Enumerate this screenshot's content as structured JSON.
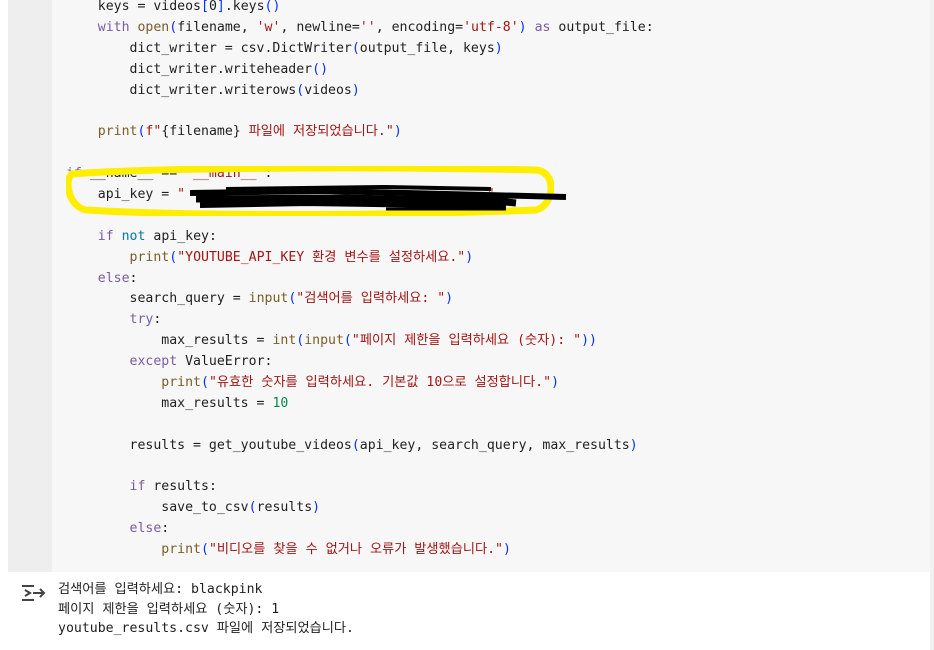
{
  "code_lines": [
    [
      {
        "t": "    keys = videos"
      },
      {
        "t": "[",
        "c": "br"
      },
      {
        "t": "0"
      },
      {
        "t": "]",
        "c": "br"
      },
      {
        "t": ".keys"
      },
      {
        "t": "()",
        "c": "br"
      }
    ],
    [
      {
        "t": "    "
      },
      {
        "t": "with",
        "c": "kw"
      },
      {
        "t": " "
      },
      {
        "t": "open",
        "c": "bi"
      },
      {
        "t": "(",
        "c": "br"
      },
      {
        "t": "filename, "
      },
      {
        "t": "'w'",
        "c": "str"
      },
      {
        "t": ", newline="
      },
      {
        "t": "''",
        "c": "str"
      },
      {
        "t": ", encoding="
      },
      {
        "t": "'utf-8'",
        "c": "str"
      },
      {
        "t": ")",
        "c": "br"
      },
      {
        "t": " "
      },
      {
        "t": "as",
        "c": "kw"
      },
      {
        "t": " output_file:"
      }
    ],
    [
      {
        "t": "        dict_writer = csv.DictWriter"
      },
      {
        "t": "(",
        "c": "br"
      },
      {
        "t": "output_file, keys"
      },
      {
        "t": ")",
        "c": "br"
      }
    ],
    [
      {
        "t": "        dict_writer.writeheader"
      },
      {
        "t": "()",
        "c": "br"
      }
    ],
    [
      {
        "t": "        dict_writer.writerows"
      },
      {
        "t": "(",
        "c": "br"
      },
      {
        "t": "videos"
      },
      {
        "t": ")",
        "c": "br"
      }
    ],
    [
      {
        "t": ""
      }
    ],
    [
      {
        "t": "    "
      },
      {
        "t": "print",
        "c": "bi"
      },
      {
        "t": "(",
        "c": "br"
      },
      {
        "t": "f\"",
        "c": "str"
      },
      {
        "t": "{filename}"
      },
      {
        "t": " 파일에 저장되었습니다.\"",
        "c": "str"
      },
      {
        "t": ")",
        "c": "br"
      }
    ],
    [
      {
        "t": ""
      }
    ],
    [
      {
        "t": "if",
        "c": "kw"
      },
      {
        "t": " __name__ == "
      },
      {
        "t": "\"__main__\"",
        "c": "str"
      },
      {
        "t": ":"
      }
    ],
    [
      {
        "t": "    api_key = "
      },
      {
        "t": "\"                                      \"",
        "c": "str"
      }
    ],
    [
      {
        "t": ""
      }
    ],
    [
      {
        "t": "    "
      },
      {
        "t": "if",
        "c": "kw"
      },
      {
        "t": " "
      },
      {
        "t": "not",
        "c": "kw2"
      },
      {
        "t": " api_key:"
      }
    ],
    [
      {
        "t": "        "
      },
      {
        "t": "print",
        "c": "bi"
      },
      {
        "t": "(",
        "c": "br"
      },
      {
        "t": "\"YOUTUBE_API_KEY 환경 변수를 설정하세요.\"",
        "c": "str"
      },
      {
        "t": ")",
        "c": "br"
      }
    ],
    [
      {
        "t": "    "
      },
      {
        "t": "else",
        "c": "kw"
      },
      {
        "t": ":"
      }
    ],
    [
      {
        "t": "        search_query = "
      },
      {
        "t": "input",
        "c": "bi"
      },
      {
        "t": "(",
        "c": "br"
      },
      {
        "t": "\"검색어를 입력하세요: \"",
        "c": "str"
      },
      {
        "t": ")",
        "c": "br"
      }
    ],
    [
      {
        "t": "        "
      },
      {
        "t": "try",
        "c": "kw"
      },
      {
        "t": ":"
      }
    ],
    [
      {
        "t": "            max_results = "
      },
      {
        "t": "int",
        "c": "bi"
      },
      {
        "t": "(",
        "c": "br"
      },
      {
        "t": "input",
        "c": "bi"
      },
      {
        "t": "(",
        "c": "br"
      },
      {
        "t": "\"페이지 제한을 입력하세요 (숫자): \"",
        "c": "str"
      },
      {
        "t": "))",
        "c": "br"
      }
    ],
    [
      {
        "t": "        "
      },
      {
        "t": "except",
        "c": "kw"
      },
      {
        "t": " ValueError:"
      }
    ],
    [
      {
        "t": "            "
      },
      {
        "t": "print",
        "c": "bi"
      },
      {
        "t": "(",
        "c": "br"
      },
      {
        "t": "\"유효한 숫자를 입력하세요. 기본값 10으로 설정합니다.\"",
        "c": "str"
      },
      {
        "t": ")",
        "c": "br"
      }
    ],
    [
      {
        "t": "            max_results = "
      },
      {
        "t": "10",
        "c": "num"
      }
    ],
    [
      {
        "t": ""
      }
    ],
    [
      {
        "t": "        results = get_youtube_videos"
      },
      {
        "t": "(",
        "c": "br"
      },
      {
        "t": "api_key, search_query, max_results"
      },
      {
        "t": ")",
        "c": "br"
      }
    ],
    [
      {
        "t": ""
      }
    ],
    [
      {
        "t": "        "
      },
      {
        "t": "if",
        "c": "kw"
      },
      {
        "t": " results:"
      }
    ],
    [
      {
        "t": "            save_to_csv"
      },
      {
        "t": "(",
        "c": "br"
      },
      {
        "t": "results"
      },
      {
        "t": ")",
        "c": "br"
      }
    ],
    [
      {
        "t": "        "
      },
      {
        "t": "else",
        "c": "kw"
      },
      {
        "t": ":"
      }
    ],
    [
      {
        "t": "            "
      },
      {
        "t": "print",
        "c": "bi"
      },
      {
        "t": "(",
        "c": "br"
      },
      {
        "t": "\"비디오를 찾을 수 없거나 오류가 발생했습니다.\"",
        "c": "str"
      },
      {
        "t": ")",
        "c": "br"
      }
    ]
  ],
  "output": {
    "icon": "output-toggle-icon",
    "lines": [
      "검색어를 입력하세요: blackpink",
      "페이지 제한을 입력하세요 (숫자): 1",
      "youtube_results.csv 파일에 저장되었습니다."
    ]
  },
  "colors": {
    "highlight": "#ffee00",
    "redaction": "#000000",
    "cell_background": "#f7f7f7"
  }
}
